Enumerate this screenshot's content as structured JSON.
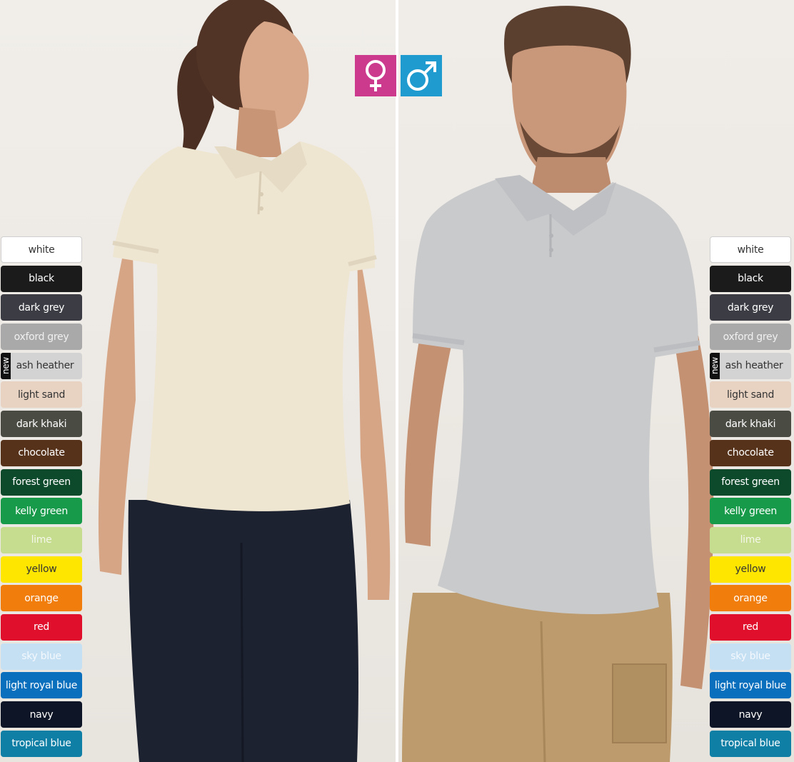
{
  "gender_icons": {
    "female": {
      "icon": "female-symbol-icon",
      "color": "#cc3a8e"
    },
    "male": {
      "icon": "male-symbol-icon",
      "color": "#1f9bcf"
    }
  },
  "new_badge": "new",
  "colors": [
    {
      "id": "white",
      "label": "white",
      "bg": "#ffffff",
      "fg": "#333333"
    },
    {
      "id": "black",
      "label": "black",
      "bg": "#1b1b1b",
      "fg": "#ffffff"
    },
    {
      "id": "dark-grey",
      "label": "dark grey",
      "bg": "#3c3d44",
      "fg": "#ffffff"
    },
    {
      "id": "oxford-grey",
      "label": "oxford grey",
      "bg": "#a9a9a9",
      "fg": "#f0f0f0"
    },
    {
      "id": "ash-heather",
      "label": "ash heather",
      "bg": "#d3d3d3",
      "fg": "#333333",
      "new": true
    },
    {
      "id": "light-sand",
      "label": "light sand",
      "bg": "#e8d2c2",
      "fg": "#333333"
    },
    {
      "id": "dark-khaki",
      "label": "dark khaki",
      "bg": "#4a4c44",
      "fg": "#ffffff"
    },
    {
      "id": "chocolate",
      "label": "chocolate",
      "bg": "#57321a",
      "fg": "#ffffff"
    },
    {
      "id": "forest-green",
      "label": "forest green",
      "bg": "#0d4a2c",
      "fg": "#ffffff"
    },
    {
      "id": "kelly-green",
      "label": "kelly green",
      "bg": "#179a4a",
      "fg": "#ffffff"
    },
    {
      "id": "lime",
      "label": "lime",
      "bg": "#c6dc8e",
      "fg": "#f4f8ea"
    },
    {
      "id": "yellow",
      "label": "yellow",
      "bg": "#ffe600",
      "fg": "#333333"
    },
    {
      "id": "orange",
      "label": "orange",
      "bg": "#f07d0c",
      "fg": "#ffffff"
    },
    {
      "id": "red",
      "label": "red",
      "bg": "#e0102c",
      "fg": "#ffffff"
    },
    {
      "id": "sky-blue",
      "label": "sky blue",
      "bg": "#c5dff3",
      "fg": "#f4f9fd"
    },
    {
      "id": "light-royal-blue",
      "label": "light royal blue",
      "bg": "#0a6fbd",
      "fg": "#ffffff"
    },
    {
      "id": "navy",
      "label": "navy",
      "bg": "#0e1526",
      "fg": "#ffffff"
    },
    {
      "id": "tropical-blue",
      "label": "tropical blue",
      "bg": "#0f7fa6",
      "fg": "#ffffff"
    }
  ]
}
